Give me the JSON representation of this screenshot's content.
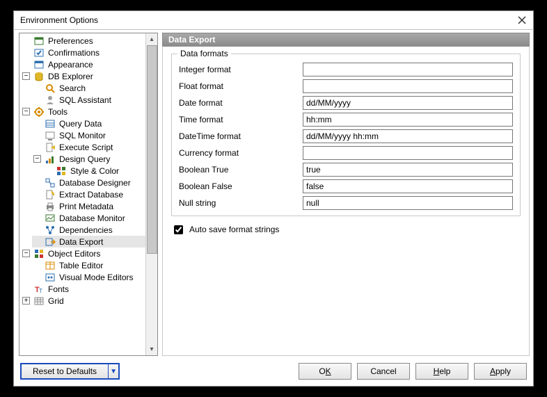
{
  "window": {
    "title": "Environment Options"
  },
  "tree": {
    "preferences": "Preferences",
    "confirmations": "Confirmations",
    "appearance": "Appearance",
    "db_explorer": "DB Explorer",
    "search": "Search",
    "sql_assistant": "SQL Assistant",
    "tools": "Tools",
    "query_data": "Query Data",
    "sql_monitor": "SQL Monitor",
    "execute_script": "Execute Script",
    "design_query": "Design Query",
    "style_color": "Style & Color",
    "database_designer": "Database Designer",
    "extract_database": "Extract Database",
    "print_metadata": "Print Metadata",
    "database_monitor": "Database Monitor",
    "dependencies": "Dependencies",
    "data_export": "Data Export",
    "object_editors": "Object Editors",
    "table_editor": "Table Editor",
    "visual_mode_editors": "Visual Mode Editors",
    "fonts": "Fonts",
    "grid": "Grid"
  },
  "panel": {
    "header": "Data Export",
    "group_legend": "Data formats",
    "fields": {
      "integer": {
        "label": "Integer format",
        "value": ""
      },
      "float": {
        "label": "Float format",
        "value": ""
      },
      "date": {
        "label": "Date format",
        "value": "dd/MM/yyyy"
      },
      "time": {
        "label": "Time format",
        "value": "hh:mm"
      },
      "datetime": {
        "label": "DateTime format",
        "value": "dd/MM/yyyy hh:mm"
      },
      "currency": {
        "label": "Currency format",
        "value": ""
      },
      "bool_true": {
        "label": "Boolean True",
        "value": "true"
      },
      "bool_false": {
        "label": "Boolean False",
        "value": "false"
      },
      "null_string": {
        "label": "Null string",
        "value": "null"
      }
    },
    "auto_save": "Auto save format strings",
    "auto_save_checked": true
  },
  "footer": {
    "reset": "Reset to Defaults",
    "ok_pre": "O",
    "ok_u": "K",
    "cancel": "Cancel",
    "help_u": "H",
    "help_post": "elp",
    "apply_u": "A",
    "apply_post": "pply"
  }
}
